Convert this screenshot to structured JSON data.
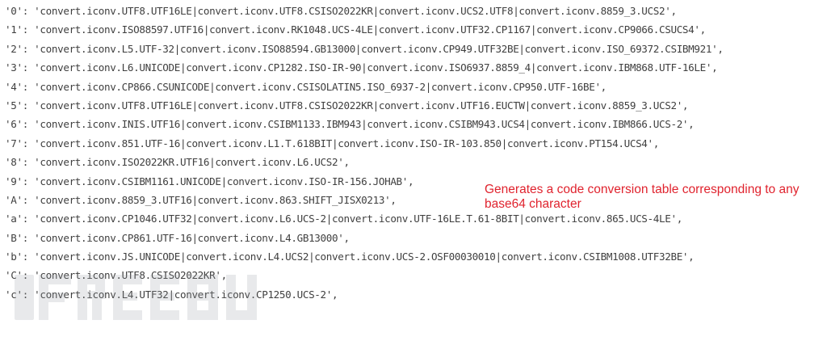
{
  "code": {
    "lines": [
      {
        "key": "'0'",
        "value": "'convert.iconv.UTF8.UTF16LE|convert.iconv.UTF8.CSISO2022KR|convert.iconv.UCS2.UTF8|convert.iconv.8859_3.UCS2',"
      },
      {
        "key": "'1'",
        "value": "'convert.iconv.ISO88597.UTF16|convert.iconv.RK1048.UCS-4LE|convert.iconv.UTF32.CP1167|convert.iconv.CP9066.CSUCS4',"
      },
      {
        "key": "'2'",
        "value": "'convert.iconv.L5.UTF-32|convert.iconv.ISO88594.GB13000|convert.iconv.CP949.UTF32BE|convert.iconv.ISO_69372.CSIBM921',"
      },
      {
        "key": "'3'",
        "value": "'convert.iconv.L6.UNICODE|convert.iconv.CP1282.ISO-IR-90|convert.iconv.ISO6937.8859_4|convert.iconv.IBM868.UTF-16LE',"
      },
      {
        "key": "'4'",
        "value": "'convert.iconv.CP866.CSUNICODE|convert.iconv.CSISOLATIN5.ISO_6937-2|convert.iconv.CP950.UTF-16BE',"
      },
      {
        "key": "'5'",
        "value": "'convert.iconv.UTF8.UTF16LE|convert.iconv.UTF8.CSISO2022KR|convert.iconv.UTF16.EUCTW|convert.iconv.8859_3.UCS2',"
      },
      {
        "key": "'6'",
        "value": "'convert.iconv.INIS.UTF16|convert.iconv.CSIBM1133.IBM943|convert.iconv.CSIBM943.UCS4|convert.iconv.IBM866.UCS-2',"
      },
      {
        "key": "'7'",
        "value": "'convert.iconv.851.UTF-16|convert.iconv.L1.T.618BIT|convert.iconv.ISO-IR-103.850|convert.iconv.PT154.UCS4',"
      },
      {
        "key": "'8'",
        "value": "'convert.iconv.ISO2022KR.UTF16|convert.iconv.L6.UCS2',"
      },
      {
        "key": "'9'",
        "value": "'convert.iconv.CSIBM1161.UNICODE|convert.iconv.ISO-IR-156.JOHAB',"
      },
      {
        "key": "'A'",
        "value": "'convert.iconv.8859_3.UTF16|convert.iconv.863.SHIFT_JISX0213',"
      },
      {
        "key": "'a'",
        "value": "'convert.iconv.CP1046.UTF32|convert.iconv.L6.UCS-2|convert.iconv.UTF-16LE.T.61-8BIT|convert.iconv.865.UCS-4LE',"
      },
      {
        "key": "'B'",
        "value": "'convert.iconv.CP861.UTF-16|convert.iconv.L4.GB13000',"
      },
      {
        "key": "'b'",
        "value": "'convert.iconv.JS.UNICODE|convert.iconv.L4.UCS2|convert.iconv.UCS-2.OSF00030010|convert.iconv.CSIBM1008.UTF32BE',"
      },
      {
        "key": "'C'",
        "value": "'convert.iconv.UTF8.CSISO2022KR',"
      },
      {
        "key": "'c'",
        "value": "'convert.iconv.L4.UTF32|convert.iconv.CP1250.UCS-2',"
      }
    ]
  },
  "annotation": {
    "text": "Generates a code conversion table corresponding to any base64 character",
    "color": "#e0232e"
  },
  "watermark": {
    "text": "FREEBUF"
  }
}
